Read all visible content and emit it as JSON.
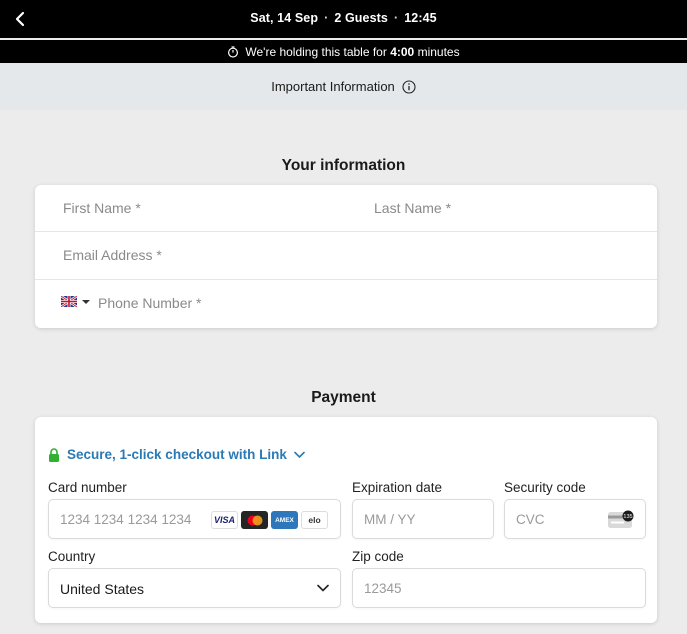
{
  "header": {
    "date": "Sat, 14 Sep",
    "guests": "2 Guests",
    "time": "12:45",
    "separator": "·"
  },
  "hold_bar": {
    "prefix": "We're holding this table for",
    "time_left": "4:00",
    "suffix": "minutes"
  },
  "info_bar": {
    "label": "Important Information"
  },
  "your_information": {
    "title": "Your information",
    "first_name_placeholder": "First Name *",
    "last_name_placeholder": "Last Name *",
    "email_placeholder": "Email Address *",
    "phone_placeholder": "Phone Number *",
    "country_flag": "uk-flag-icon"
  },
  "payment": {
    "title": "Payment",
    "link_label": "Secure, 1-click checkout with Link",
    "card_number_label": "Card number",
    "card_number_placeholder": "1234 1234 1234 1234",
    "card_brands": [
      "VISA",
      "Mastercard",
      "AMEX",
      "elo"
    ],
    "expiration_label": "Expiration date",
    "expiration_placeholder": "MM / YY",
    "security_label": "Security code",
    "security_placeholder": "CVC",
    "country_label": "Country",
    "country_value": "United States",
    "zip_label": "Zip code",
    "zip_placeholder": "12345"
  },
  "colors": {
    "link_blue": "#2a7ab5",
    "lock_green": "#30b130",
    "header_bg": "#000000",
    "info_bg": "#e4e8eb"
  }
}
